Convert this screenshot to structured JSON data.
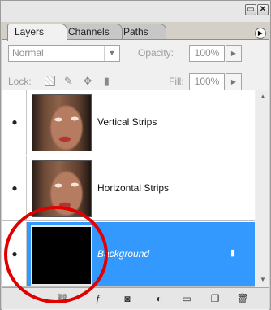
{
  "tabs": [
    {
      "label": "Layers",
      "active": true
    },
    {
      "label": "Channels",
      "active": false
    },
    {
      "label": "Paths",
      "active": false
    }
  ],
  "blend_mode": "Normal",
  "opacity": {
    "label": "Opacity:",
    "value": "100%"
  },
  "lock": {
    "label": "Lock:"
  },
  "fill": {
    "label": "Fill:",
    "value": "100%"
  },
  "layers": [
    {
      "name": "Vertical Strips",
      "visible": true,
      "selected": false,
      "locked": false
    },
    {
      "name": "Horizontal Strips",
      "visible": true,
      "selected": false,
      "locked": false
    },
    {
      "name": "Background",
      "visible": true,
      "selected": true,
      "locked": true
    }
  ],
  "colors": {
    "selection": "#3399ff",
    "annotation": "#e00000",
    "panel": "#d4d0c8"
  },
  "icons": {
    "eye": "eye-icon",
    "link": "link-layers-icon",
    "fx": "layer-style-icon",
    "mask": "add-mask-icon",
    "adjustment": "adjustment-layer-icon",
    "group": "new-group-icon",
    "new": "new-layer-icon",
    "trash": "delete-layer-icon"
  }
}
